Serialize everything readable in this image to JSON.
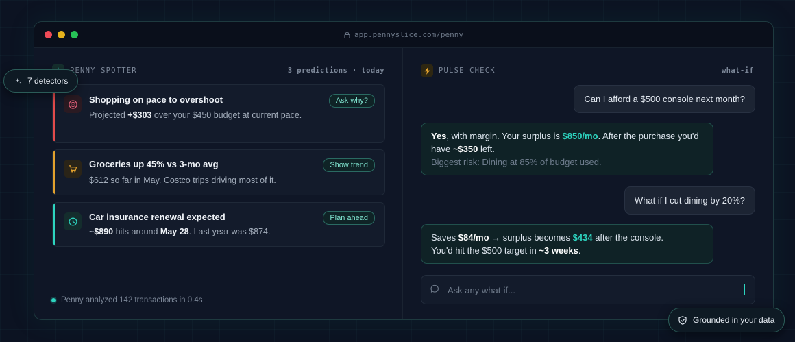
{
  "browser": {
    "url": "app.pennyslice.com/penny"
  },
  "spotter": {
    "title": "PENNY SPOTTER",
    "meta": "3 predictions · today",
    "cards": [
      {
        "title": "Shopping on pace to overshoot",
        "desc_prefix": "Projected ",
        "desc_bold1": "+$303",
        "desc_suffix": " over your $450 budget at current pace.",
        "button": "Ask why?",
        "accent": "#e24b4b",
        "icon": "target-icon"
      },
      {
        "title": "Groceries up 45% vs 3-mo avg",
        "desc": "$612 so far in May. Costco trips driving most of it.",
        "button": "Show trend",
        "accent": "#e2a12d",
        "icon": "cart-icon"
      },
      {
        "title": "Car insurance renewal expected",
        "desc_prefix": "~",
        "desc_bold1": "$890",
        "desc_mid": " hits around ",
        "desc_bold2": "May 28",
        "desc_suffix": ". Last year was $874.",
        "button": "Plan ahead",
        "accent": "#2dd4bf",
        "icon": "clock-icon"
      }
    ],
    "footer": "Penny analyzed 142 transactions in 0.4s"
  },
  "pulse": {
    "title": "PULSE CHECK",
    "meta": "what-if",
    "messages": [
      {
        "role": "user",
        "text": "Can I afford a $500 console next month?"
      },
      {
        "role": "ai",
        "p1_bold": "Yes",
        "p1_text": ", with margin. Your surplus is ",
        "p1_amount": "$850/mo",
        "p1_text2": ". After the purchase you'd have ",
        "p1_bold2": "~$350",
        "p1_text3": " left.",
        "risk": "Biggest risk: Dining at 85% of budget used."
      },
      {
        "role": "user",
        "text": "What if I cut dining by 20%?"
      },
      {
        "role": "ai",
        "t1": "Saves ",
        "b1": "$84/mo",
        "t2": " → surplus becomes ",
        "amount": "$434",
        "t3": " after the console.",
        "t4": "You'd hit the $500 target in ",
        "b2": "~3 weeks",
        "t5": "."
      }
    ],
    "input_placeholder": "Ask any what-if..."
  },
  "badges": {
    "detectors": "7 detectors",
    "grounded": "Grounded in your data"
  },
  "colors": {
    "teal": "#2dd4bf",
    "amber": "#e2a12d",
    "red": "#e24b4b"
  }
}
